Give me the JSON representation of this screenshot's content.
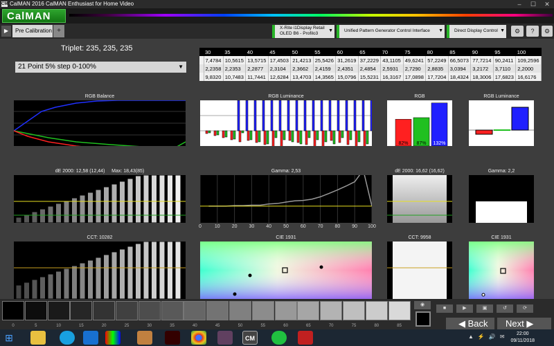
{
  "window": {
    "app_icon_text": "CM",
    "title": "CalMAN 2016 CalMAN Enthusiast for Home Video",
    "controls": [
      "–",
      "☐",
      "✕"
    ]
  },
  "logo": "CalMAN",
  "toolbar": {
    "nav_arrow": "▶",
    "tab_label": "Pre Calibration",
    "add_tab": "+",
    "devices": [
      {
        "line1": "X-Rite i1Display Retail",
        "line2": "OLED B6 - Profilo3",
        "dd": "▼"
      },
      {
        "line1": "Unified Pattern Generator Control Interface",
        "line2": "",
        "dd": "▼"
      },
      {
        "line1": "Direct Display Control",
        "line2": "",
        "dd": "▼"
      }
    ],
    "buttons": [
      "⚙",
      "?",
      "⚙"
    ],
    "menu_arrow": "▼"
  },
  "triplet": "Triplet: 235, 235, 235",
  "mode_select": {
    "value": "21 Point 5% step 0-100%",
    "dd": "▼"
  },
  "table": {
    "header": [
      "",
      "30",
      "35",
      "40",
      "45",
      "50",
      "55",
      "60",
      "65",
      "70",
      "75",
      "80",
      "85",
      "90",
      "95",
      "100"
    ],
    "rows": [
      [
        "",
        "7,4784",
        "10,5615",
        "13,5715",
        "17,4503",
        "21,4213",
        "25,5426",
        "31,2619",
        "37,2229",
        "43,1105",
        "49,6241",
        "57,2249",
        "66,5073",
        "77,7214",
        "90,2411",
        "109,2596"
      ],
      [
        "",
        "2,2358",
        "2,2353",
        "2,2877",
        "2,3104",
        "2,3662",
        "2,4159",
        "2,4351",
        "2,4854",
        "2,5931",
        "2,7290",
        "2,8835",
        "3,0394",
        "3,2172",
        "3,7110",
        "2,2000"
      ],
      [
        "",
        "9,8320",
        "10,7483",
        "11,7441",
        "12,6284",
        "13,4703",
        "14,3565",
        "15,0796",
        "15,5231",
        "16,3167",
        "17,0898",
        "17,7204",
        "18,4324",
        "18,3006",
        "17,6823",
        "16,6176"
      ]
    ]
  },
  "charts": {
    "rgb_balance": {
      "title": "RGB Balance"
    },
    "rgb_luminance": {
      "title": "RGB Luminance"
    },
    "rgb": {
      "title": "RGB",
      "values": [
        82,
        87,
        132
      ],
      "labels": [
        "82%",
        "87%",
        "132%"
      ],
      "colors": [
        "#ff2020",
        "#20c020",
        "#2020ff"
      ]
    },
    "rgb_luminance_small": {
      "title": "RGB Luminance"
    },
    "de2000_bars": {
      "title": "dE 2000:",
      "current": "12,58",
      "avg": "(12,44)",
      "max_label": "Max:",
      "max": "18,43",
      "max_at": "(85)"
    },
    "gamma": {
      "title": "Gamma: 2,53",
      "x_ticks": [
        "0",
        "10",
        "20",
        "30",
        "40",
        "50",
        "60",
        "70",
        "80",
        "90",
        "100"
      ],
      "xlim": [
        0,
        100
      ],
      "ylim": [
        1.5,
        3.5
      ],
      "target": 2.2,
      "x": [
        5,
        10,
        15,
        20,
        25,
        30,
        35,
        40,
        45,
        50,
        55,
        60,
        65,
        70,
        75,
        80,
        85,
        90,
        95,
        100
      ],
      "y": [
        2.2,
        2.2,
        2.2,
        2.22,
        2.22,
        2.24,
        2.24,
        2.29,
        2.31,
        2.37,
        2.42,
        2.44,
        2.49,
        2.59,
        2.73,
        2.88,
        3.04,
        3.22,
        3.71,
        2.2
      ]
    },
    "de2000_single": {
      "title": "dE 2000: 16,62 (16,62)"
    },
    "gamma_small": {
      "title": "Gamma: 2,2"
    },
    "cct_bars": {
      "title": "CCT: 10282"
    },
    "cie": {
      "title": "CIE 1931"
    },
    "cct_single": {
      "title": "CCT: 9958"
    },
    "cie_small": {
      "title": "CIE 1931"
    }
  },
  "swatches": {
    "labels": [
      "0",
      "5",
      "10",
      "15",
      "20",
      "25",
      "30",
      "35",
      "40",
      "45",
      "50",
      "55",
      "60",
      "65",
      "70",
      "75",
      "80",
      "85"
    ],
    "grays": [
      "#000000",
      "#0d0d0d",
      "#1a1a1a",
      "#262626",
      "#333333",
      "#404040",
      "#4d4d4d",
      "#595959",
      "#666666",
      "#737373",
      "#808080",
      "#8c8c8c",
      "#999999",
      "#a6a6a6",
      "#b3b3b3",
      "#bfbfbf",
      "#cccccc",
      "#d9d9d9"
    ]
  },
  "controls": {
    "back": "Back",
    "next": "Next",
    "icons": [
      "◉",
      "■",
      "▶",
      "▣",
      "↺",
      "⟳"
    ]
  },
  "taskbar": {
    "time": "22:00",
    "date": "09/11/2018",
    "cm_label": "CM",
    "tray": [
      "▲",
      "⚡",
      "🔊",
      "✉"
    ]
  }
}
